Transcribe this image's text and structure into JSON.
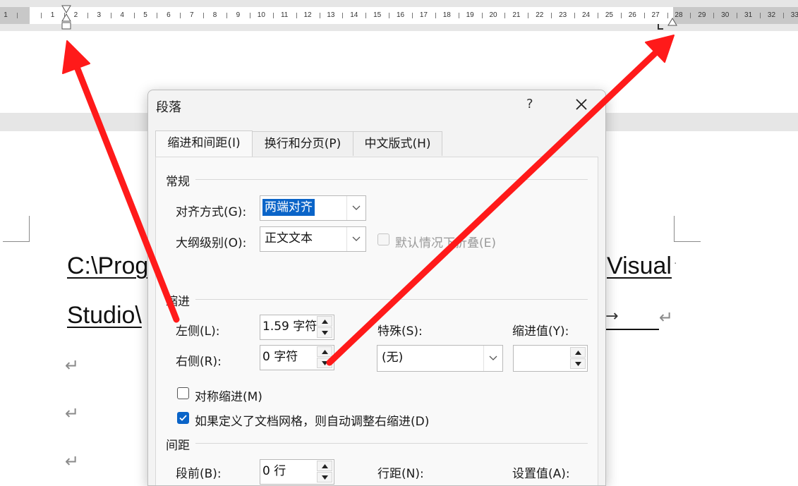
{
  "ruler": {
    "left_numbers": [
      "1"
    ],
    "numbers": [
      "1",
      "2",
      "3",
      "4",
      "5",
      "6",
      "7",
      "8",
      "9",
      "10",
      "11",
      "12",
      "13",
      "14",
      "15",
      "16",
      "17",
      "18",
      "19",
      "20",
      "21",
      "22",
      "23",
      "24",
      "25",
      "26",
      "27",
      "28",
      "29",
      "30",
      "31",
      "32",
      "33"
    ]
  },
  "document": {
    "line1_left": "C:\\Prog",
    "line1_right": "Visual",
    "line2_left": "Studio\\",
    "tab_arrow": "→",
    "para_mark": "↵"
  },
  "dialog": {
    "title": "段落",
    "help": "?",
    "tabs": [
      {
        "label": "缩进和间距(I)",
        "active": true
      },
      {
        "label": "换行和分页(P)",
        "active": false
      },
      {
        "label": "中文版式(H)",
        "active": false
      }
    ],
    "general": {
      "section_label": "常规",
      "alignment_label": "对齐方式(G):",
      "alignment_value": "两端对齐",
      "outline_label": "大纲级别(O):",
      "outline_value": "正文文本",
      "collapse_label": "默认情况下折叠(E)"
    },
    "indent": {
      "section_label": "缩进",
      "left_label": "左侧(L):",
      "left_value": "1.59 字符",
      "right_label": "右侧(R):",
      "right_value": "0 字符",
      "special_label": "特殊(S):",
      "special_value": "(无)",
      "indent_by_label": "缩进值(Y):",
      "indent_by_value": "",
      "mirror_label": "对称缩进(M)",
      "mirror_checked": false,
      "auto_adjust_label": "如果定义了文档网格，则自动调整右缩进(D)",
      "auto_adjust_checked": true
    },
    "spacing": {
      "section_label": "间距",
      "before_label": "段前(B):",
      "before_value": "0 行",
      "line_spacing_label": "行距(N):",
      "at_label": "设置值(A):"
    }
  },
  "colors": {
    "accent": "#0a64c8",
    "annotation": "#ff1a1a"
  }
}
